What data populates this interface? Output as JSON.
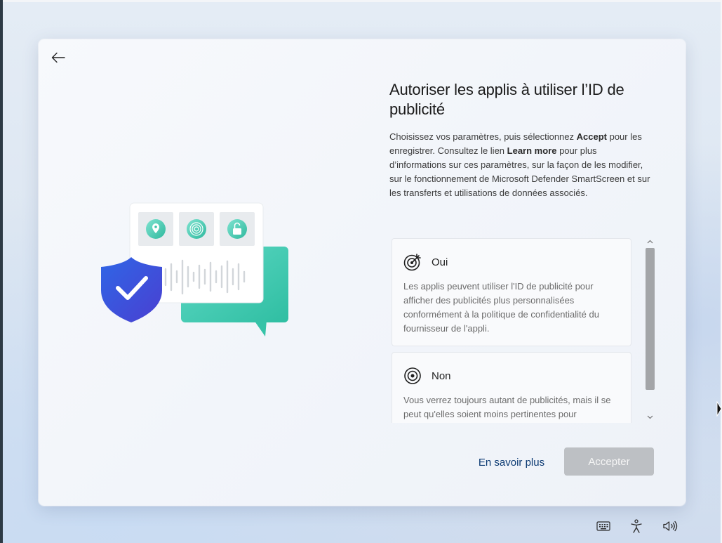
{
  "window": {
    "title": "Autoriser les applis à utiliser l’ID de publicité",
    "description_parts": {
      "p1": "Choisissez vos paramètres, puis sélectionnez ",
      "accept_bold": "Accept",
      "p2": " pour les enregistrer. Consultez le lien ",
      "learn_bold": "Learn more",
      "p3": " pour plus d’informations sur ces paramètres, sur la façon de les modifier, sur le fonctionnement de Microsoft Defender SmartScreen et sur les transferts et utilisations de données associés."
    }
  },
  "options": [
    {
      "label": "Oui",
      "icon": "target-arrow-icon",
      "text": "Les applis peuvent utiliser l'ID de publicité pour afficher des publicités plus personnalisées conformément à la politique de confidentialité du fournisseur de l'appli."
    },
    {
      "label": "Non",
      "icon": "target-icon",
      "text": "Vous verrez toujours autant de publicités, mais il se peut qu'elles soient moins pertinentes pour"
    }
  ],
  "buttons": {
    "learn_more": "En savoir plus",
    "accept": "Accepter"
  },
  "illustration": {
    "icons": [
      "location-pin-icon",
      "fingerprint-icon",
      "unlocked-padlock-icon",
      "shield-check-icon"
    ]
  },
  "tray": {
    "icons": [
      "keyboard-icon",
      "accessibility-icon",
      "volume-icon"
    ]
  },
  "colors": {
    "accent_link": "#0c3a73",
    "button_disabled": "#bdc0c4",
    "shield_blue": "#3d5ae0",
    "bubble_teal": "#3ecbb0"
  }
}
